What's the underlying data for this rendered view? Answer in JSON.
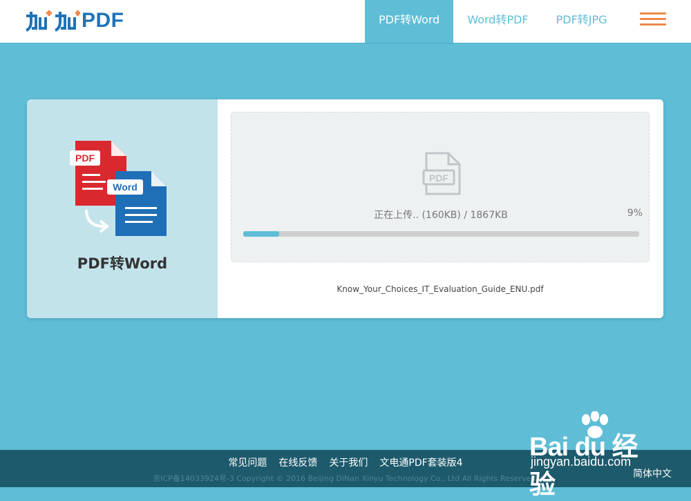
{
  "header": {
    "logo_text": "加加PDF",
    "tabs": [
      {
        "label": "PDF转Word",
        "active": true
      },
      {
        "label": "Word转PDF",
        "active": false
      },
      {
        "label": "PDF转JPG",
        "active": false
      }
    ],
    "menu_icon": "hamburger-menu-icon",
    "accent_color": "#f0874a"
  },
  "converter": {
    "title": "PDF转Word",
    "illustration_labels": {
      "pdf": "PDF",
      "word": "Word"
    },
    "file_icon_label": "PDF",
    "upload_status": "正在上传.. (160KB) / 1867KB",
    "progress_percent_text": "9%",
    "progress_value": 9,
    "filename": "Know_Your_Choices_IT_Evaluation_Guide_ENU.pdf"
  },
  "footer": {
    "links": [
      "常见问题",
      "在线反馈",
      "关于我们",
      "文电通PDF套装版4"
    ],
    "copyright": "京ICP备14033924号-3 Copyright © 2016 Beijing DiNan Xinyu Technology Co., Ltd All Rights Reserved.",
    "language": "简体中文"
  },
  "watermark": {
    "brand": "Bai du 经验",
    "url": "jingyan.baidu.com"
  },
  "colors": {
    "background": "#5fbdd6",
    "footer": "#1d5a6c",
    "pdf_red": "#d9282e",
    "word_blue": "#1f6fb7"
  }
}
